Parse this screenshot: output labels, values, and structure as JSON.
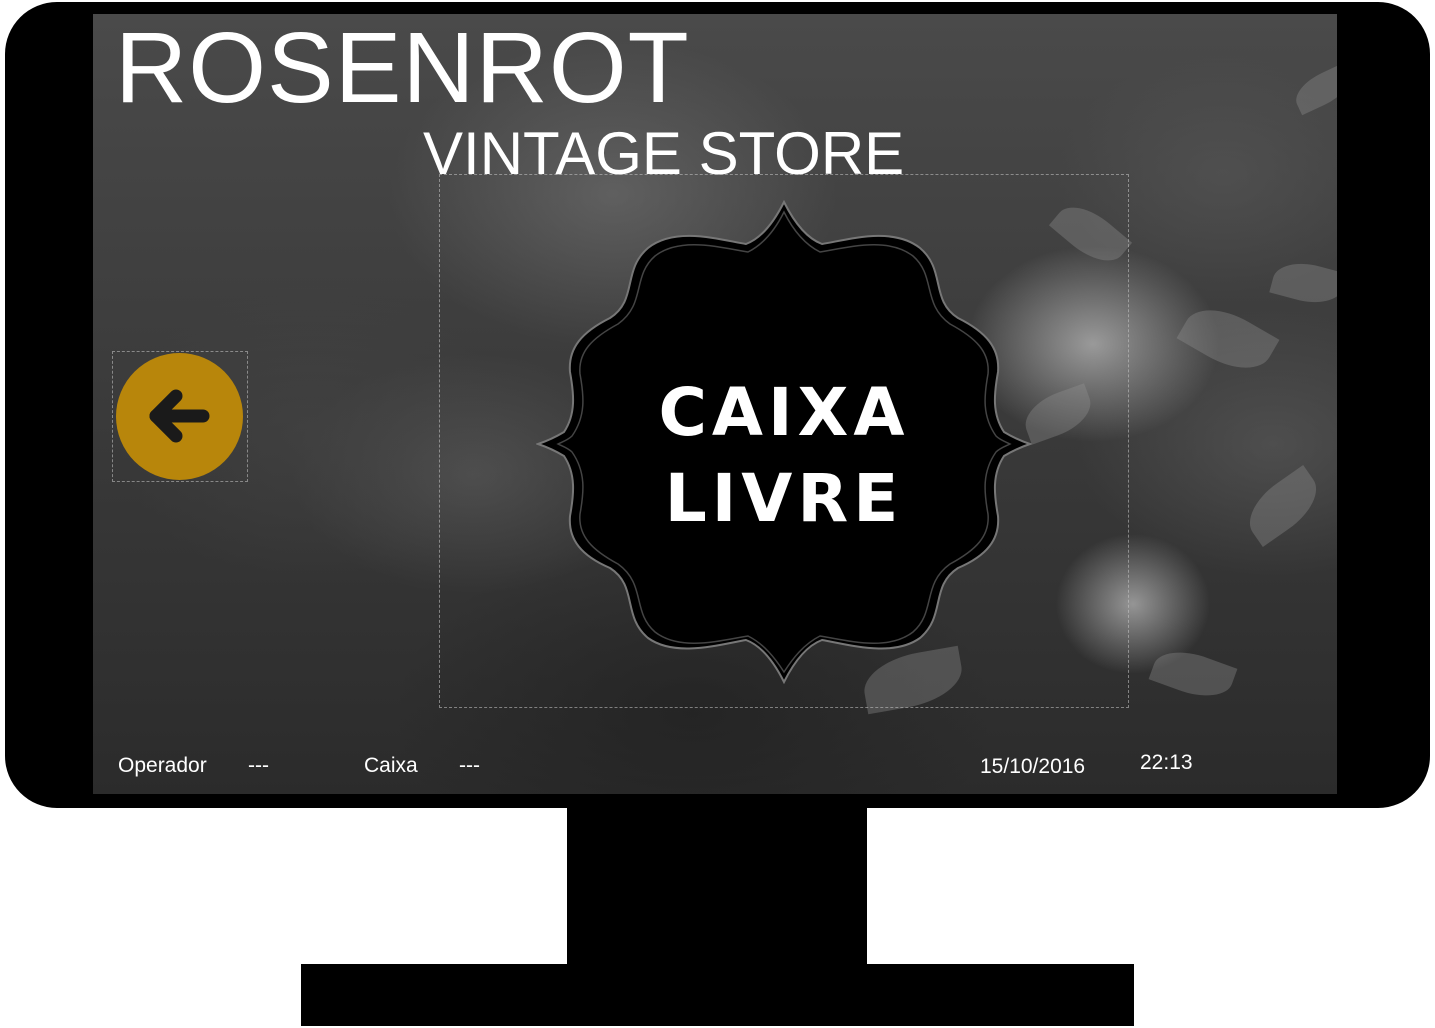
{
  "app": {
    "title": "ROSENROT",
    "subtitle": "VINTAGE STORE"
  },
  "badge": {
    "line1": "CAIXA",
    "line2": "LIVRE"
  },
  "back_button": {
    "icon": "arrow-left-icon",
    "color": "#b8860b"
  },
  "status_bar": {
    "operator_label": "Operador",
    "operator_value": "---",
    "register_label": "Caixa",
    "register_value": "---",
    "date": "15/10/2016",
    "time": "22:13"
  }
}
